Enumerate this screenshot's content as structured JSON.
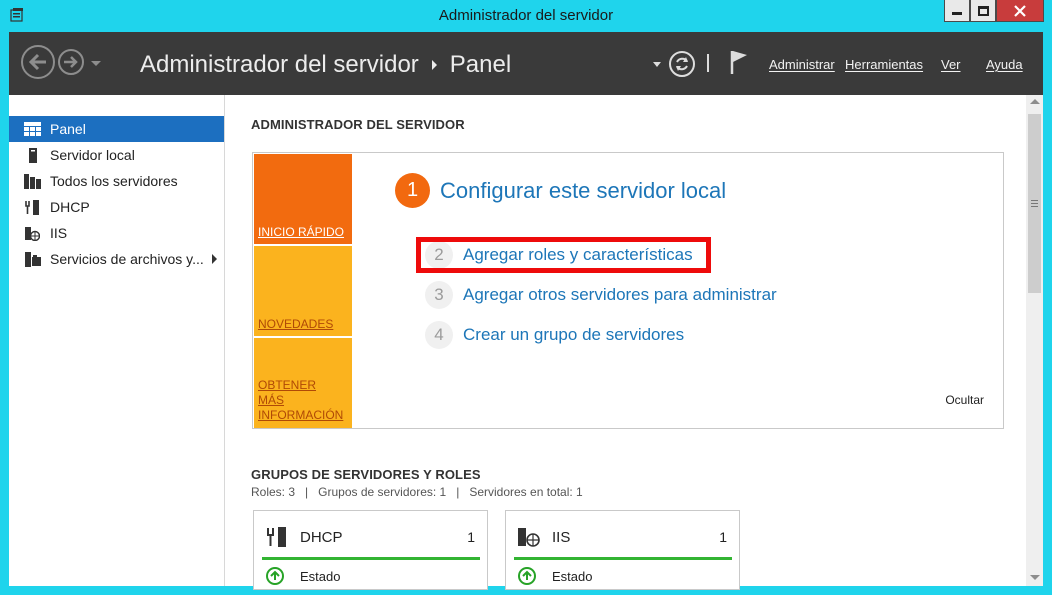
{
  "window": {
    "title": "Administrador del servidor"
  },
  "header": {
    "breadcrumb_root": "Administrador del servidor",
    "breadcrumb_current": "Panel",
    "menu": {
      "manage": "Administrar",
      "tools": "Herramientas",
      "view": "Ver",
      "help": "Ayuda"
    }
  },
  "sidebar": {
    "items": [
      {
        "label": "Panel",
        "icon": "dashboard-icon",
        "active": true
      },
      {
        "label": "Servidor local",
        "icon": "server-icon"
      },
      {
        "label": "Todos los servidores",
        "icon": "servers-icon"
      },
      {
        "label": "DHCP",
        "icon": "dhcp-icon"
      },
      {
        "label": "IIS",
        "icon": "iis-icon"
      },
      {
        "label": "Servicios de archivos y...",
        "icon": "file-services-icon",
        "has_submenu": true
      }
    ]
  },
  "welcome": {
    "heading": "ADMINISTRADOR DEL SERVIDOR",
    "tiles": {
      "quick_start": "INICIO RÁPIDO",
      "whats_new": "NOVEDADES",
      "learn_more": "OBTENER MÁS INFORMACIÓN"
    },
    "step1_number": "1",
    "step1_text": "Configurar este servidor local",
    "steps": [
      {
        "number": "2",
        "label": "Agregar roles y características"
      },
      {
        "number": "3",
        "label": "Agregar otros servidores para administrar"
      },
      {
        "number": "4",
        "label": "Crear un grupo de servidores"
      }
    ],
    "hide": "Ocultar"
  },
  "groups": {
    "heading": "GRUPOS DE SERVIDORES Y ROLES",
    "summary": "Roles: 3   |   Grupos de servidores: 1   |   Servidores en total: 1",
    "cards": [
      {
        "name": "DHCP",
        "count": "1",
        "status": "Estado"
      },
      {
        "name": "IIS",
        "count": "1",
        "status": "Estado"
      }
    ]
  },
  "colors": {
    "accent": "#1c6fc0",
    "link": "#1d76b8",
    "orange": "#f26b0f",
    "yellow": "#fbb31e",
    "highlight": "#ee0b0b",
    "ok": "#32b432"
  }
}
